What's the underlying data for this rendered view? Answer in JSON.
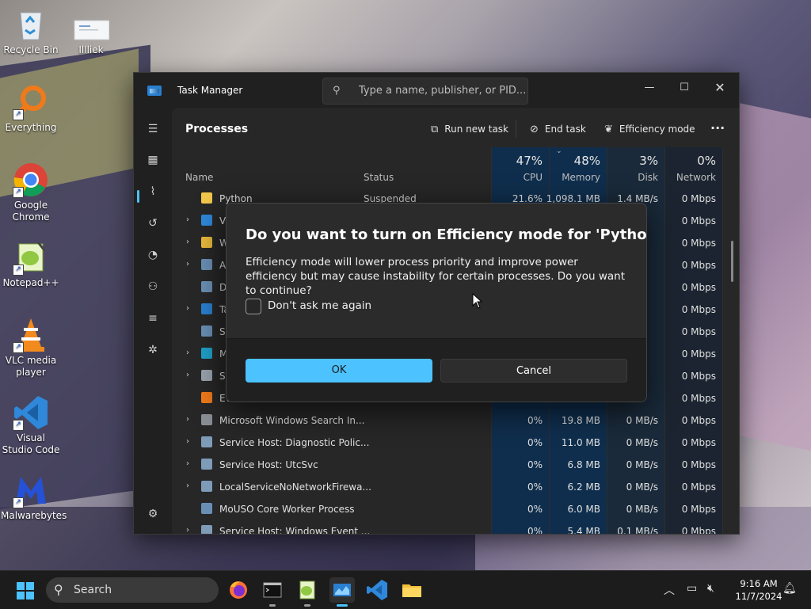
{
  "desktop": {
    "icons": [
      {
        "label": "Recycle Bin"
      },
      {
        "label": "Illliek"
      },
      {
        "label": "Everything"
      },
      {
        "label": "Google Chrome"
      },
      {
        "label": "Notepad++"
      },
      {
        "label": "VLC media player"
      },
      {
        "label": "Visual Studio Code"
      },
      {
        "label": "Malwarebytes"
      }
    ]
  },
  "task_manager": {
    "title": "Task Manager",
    "search_placeholder": "Type a name, publisher, or PID...",
    "page_title": "Processes",
    "toolbar": {
      "run_new_task": "Run new task",
      "end_task": "End task",
      "efficiency_mode": "Efficiency mode",
      "more": "···"
    },
    "columns": {
      "name": "Name",
      "status": "Status",
      "cpu_pct": "47%",
      "cpu": "CPU",
      "memory_pct": "48%",
      "memory": "Memory",
      "disk_pct": "3%",
      "disk": "Disk",
      "network_pct": "0%",
      "network": "Network"
    },
    "rows": [
      {
        "name": "Python",
        "status": "Suspended",
        "cpu": "21.6%",
        "memory": "1,098.1 MB",
        "disk": "1.4 MB/s",
        "network": "0 Mbps",
        "expand": false,
        "icon_color": "#f2c94c"
      },
      {
        "name": "Vi",
        "status": "",
        "cpu": "",
        "memory": "",
        "disk": "",
        "network": "0 Mbps",
        "expand": true,
        "icon_color": "#2f88d9"
      },
      {
        "name": "W",
        "status": "",
        "cpu": "",
        "memory": "",
        "disk": "",
        "network": "0 Mbps",
        "expand": true,
        "icon_color": "#e8b93b"
      },
      {
        "name": "A",
        "status": "",
        "cpu": "",
        "memory": "",
        "disk": "",
        "network": "0 Mbps",
        "expand": true,
        "icon_color": "#6a8fb5"
      },
      {
        "name": "D",
        "status": "",
        "cpu": "",
        "memory": "",
        "disk": "",
        "network": "0 Mbps",
        "expand": false,
        "icon_color": "#6a8fb5"
      },
      {
        "name": "Ta",
        "status": "",
        "cpu": "",
        "memory": "",
        "disk": "",
        "network": "0 Mbps",
        "expand": true,
        "icon_color": "#2a7fd0"
      },
      {
        "name": "Se",
        "status": "",
        "cpu": "",
        "memory": "",
        "disk": "",
        "network": "0 Mbps",
        "expand": false,
        "icon_color": "#6a8fb5"
      },
      {
        "name": "M",
        "status": "",
        "cpu": "",
        "memory": "",
        "disk": "",
        "network": "0 Mbps",
        "expand": true,
        "icon_color": "#1fa0c9"
      },
      {
        "name": "St",
        "status": "",
        "cpu": "",
        "memory": "",
        "disk": "",
        "network": "0 Mbps",
        "expand": true,
        "icon_color": "#9aa3ad"
      },
      {
        "name": "Ev",
        "status": "",
        "cpu": "",
        "memory": "",
        "disk": "",
        "network": "0 Mbps",
        "expand": false,
        "icon_color": "#f07a1a"
      },
      {
        "name": "Microsoft Windows Search In...",
        "status": "",
        "cpu": "0%",
        "memory": "19.8 MB",
        "disk": "0 MB/s",
        "network": "0 Mbps",
        "expand": true,
        "icon_color": "#8a8f96"
      },
      {
        "name": "Service Host: Diagnostic Polic...",
        "status": "",
        "cpu": "0%",
        "memory": "11.0 MB",
        "disk": "0 MB/s",
        "network": "0 Mbps",
        "expand": true,
        "icon_color": "#7e9bb8"
      },
      {
        "name": "Service Host: UtcSvc",
        "status": "",
        "cpu": "0%",
        "memory": "6.8 MB",
        "disk": "0 MB/s",
        "network": "0 Mbps",
        "expand": true,
        "icon_color": "#7e9bb8"
      },
      {
        "name": "LocalServiceNoNetworkFirewa...",
        "status": "",
        "cpu": "0%",
        "memory": "6.2 MB",
        "disk": "0 MB/s",
        "network": "0 Mbps",
        "expand": true,
        "icon_color": "#7e9bb8"
      },
      {
        "name": "MoUSO Core Worker Process",
        "status": "",
        "cpu": "0%",
        "memory": "6.0 MB",
        "disk": "0 MB/s",
        "network": "0 Mbps",
        "expand": false,
        "icon_color": "#6a8fb5"
      },
      {
        "name": "Service Host: Windows Event ...",
        "status": "",
        "cpu": "0%",
        "memory": "5.4 MB",
        "disk": "0.1 MB/s",
        "network": "0 Mbps",
        "expand": true,
        "icon_color": "#7e9bb8"
      }
    ]
  },
  "dialog": {
    "title": "Do you want to turn on Efficiency mode for 'Python'?",
    "message": "Efficiency mode will lower process priority and improve power efficiency but may cause instability for certain processes. Do you want to continue?",
    "checkbox_label": "Don't ask me again",
    "checkbox_checked": false,
    "ok_label": "OK",
    "cancel_label": "Cancel",
    "accent": "#4cc2ff"
  },
  "taskbar": {
    "search_label": "Search",
    "time": "9:16 AM",
    "date": "11/7/2024"
  }
}
